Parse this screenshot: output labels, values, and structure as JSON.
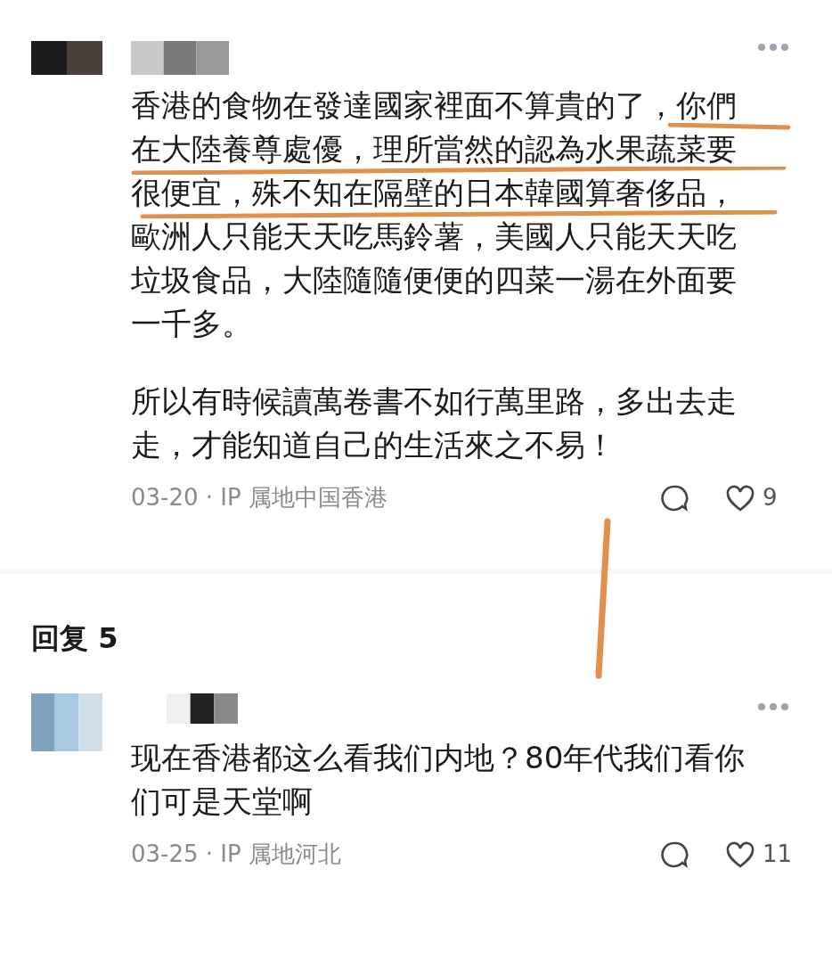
{
  "post": {
    "paragraphs": [
      [
        "香港的食物在發達國家裡面不算貴的了，你們",
        "在大陸養尊處優，理所當然的認為水果蔬菜要",
        "很便宜，殊不知在隔壁的日本韓國算奢侈品，",
        "歐洲人只能天天吃馬鈴薯，美國人只能天天吃",
        "垃圾食品，大陸隨隨便便的四菜一湯在外面要",
        "一千多。"
      ],
      [
        "所以有時候讀萬卷書不如行萬里路，多出去走",
        "走，才能知道自己的生活來之不易！"
      ]
    ],
    "meta": "03-20 · IP 属地中国香港",
    "likes": "9"
  },
  "replies_heading": "回复 5",
  "replies": [
    {
      "paragraphs": [
        [
          "现在香港都这么看我们内地？80年代我们看你",
          "们可是天堂啊"
        ]
      ],
      "meta": "03-25 · IP 属地河北",
      "likes": "11"
    }
  ]
}
